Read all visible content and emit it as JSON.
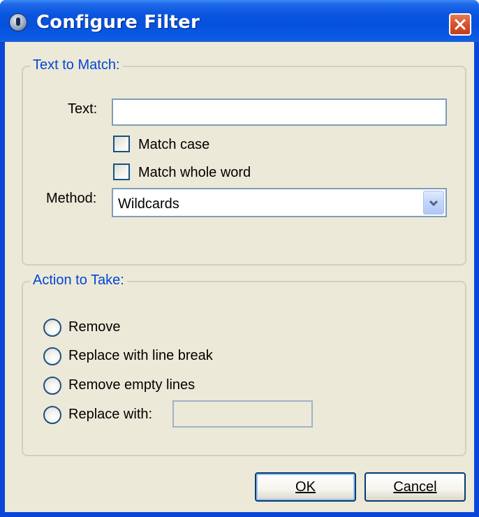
{
  "window": {
    "title": "Configure Filter"
  },
  "text_group": {
    "legend": "Text to Match:",
    "text_label": "Text:",
    "text_value": "",
    "match_case_label": "Match case",
    "match_case_checked": false,
    "match_whole_word_label": "Match whole word",
    "match_whole_word_checked": false,
    "method_label": "Method:",
    "method_value": "Wildcards"
  },
  "action_group": {
    "legend": "Action to Take:",
    "options": [
      {
        "label": "Remove",
        "selected": false
      },
      {
        "label": "Replace with line break",
        "selected": false
      },
      {
        "label": "Remove empty lines",
        "selected": false
      },
      {
        "label": "Replace with:",
        "selected": false
      }
    ],
    "replace_value": ""
  },
  "buttons": {
    "ok": "OK",
    "cancel": "Cancel"
  },
  "icons": {
    "app": "app-icon",
    "close": "close-icon",
    "dropdown": "chevron-down-icon"
  },
  "colors": {
    "title_bar": "#0a55df",
    "group_legend": "#0046d5",
    "dialog_bg": "#ece9d8",
    "close_button": "#d6532c"
  }
}
